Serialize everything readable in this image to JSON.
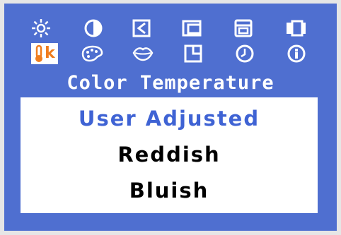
{
  "osd": {
    "menu_title": "Color Temperature",
    "options": [
      {
        "label": "User Adjusted",
        "selected": true
      },
      {
        "label": "Reddish",
        "selected": false
      },
      {
        "label": "Bluish",
        "selected": false
      }
    ],
    "icons_row1": [
      "brightness-icon",
      "contrast-icon",
      "h-position-icon",
      "size-icon",
      "v-position-icon",
      "video-mode-icon"
    ],
    "icons_row2": [
      "color-temperature-icon",
      "color-palette-icon",
      "lips-skin-tone-icon",
      "window-icon",
      "clock-icon",
      "info-icon"
    ],
    "selected_icon": "color-temperature-icon",
    "selected_icon_letter": "k",
    "colors": {
      "background": "#4f6fd0",
      "selected_text": "#3f63d4",
      "accent": "#f07d1e"
    }
  }
}
